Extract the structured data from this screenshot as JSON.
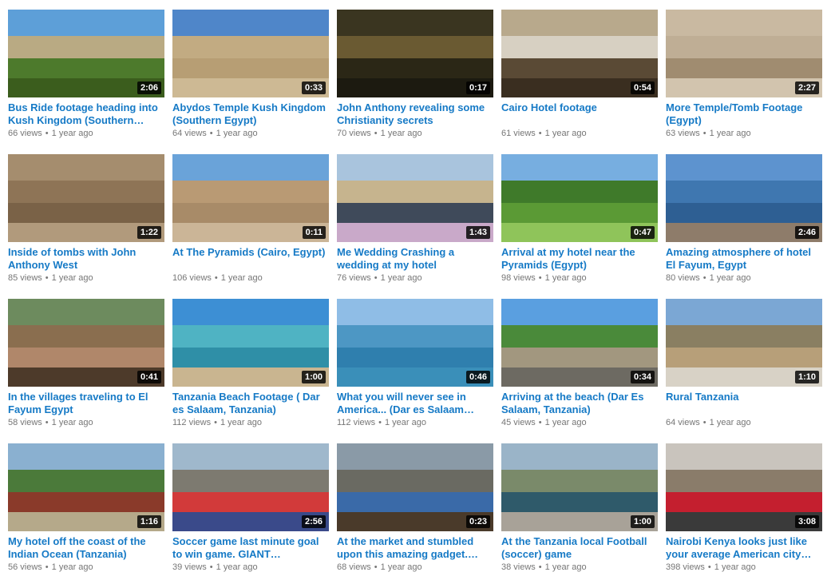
{
  "videos": [
    {
      "title": "Bus Ride footage heading into Kush Kingdom (Southern…",
      "duration": "2:06",
      "views": "66 views",
      "age": "1 year ago",
      "palette": [
        "#5d9fd8",
        "#b9aa83",
        "#4d7a2c",
        "#3b5d1d"
      ]
    },
    {
      "title": "Abydos Temple Kush Kingdom (Southern Egypt)",
      "duration": "0:33",
      "views": "64 views",
      "age": "1 year ago",
      "palette": [
        "#4f86c9",
        "#c2ab82",
        "#b79e74",
        "#cdb994"
      ]
    },
    {
      "title": "John Anthony revealing some Christianity secrets",
      "duration": "0:17",
      "views": "70 views",
      "age": "1 year ago",
      "palette": [
        "#3a3520",
        "#6a5a32",
        "#2b2716",
        "#1c1a10"
      ]
    },
    {
      "title": "Cairo Hotel footage",
      "duration": "0:54",
      "views": "61 views",
      "age": "1 year ago",
      "palette": [
        "#b8a98c",
        "#d7d0c2",
        "#5a4a35",
        "#3a2e20"
      ]
    },
    {
      "title": "More Temple/Tomb Footage (Egypt)",
      "duration": "2:27",
      "views": "63 views",
      "age": "1 year ago",
      "palette": [
        "#c9b9a1",
        "#bfae95",
        "#a08c70",
        "#d2c4ae"
      ]
    },
    {
      "title": "Inside of tombs with John Anthony West",
      "duration": "1:22",
      "views": "85 views",
      "age": "1 year ago",
      "palette": [
        "#a58d6e",
        "#8e7456",
        "#7a6247",
        "#b19a7c"
      ]
    },
    {
      "title": "At The Pyramids (Cairo, Egypt)",
      "duration": "0:11",
      "views": "106 views",
      "age": "1 year ago",
      "palette": [
        "#6aa3d9",
        "#b99a74",
        "#a88b68",
        "#cbb597"
      ]
    },
    {
      "title": "Me Wedding Crashing a wedding at my hotel",
      "duration": "1:43",
      "views": "76 views",
      "age": "1 year ago",
      "palette": [
        "#a9c4dd",
        "#c6b48e",
        "#3f4a5a",
        "#c9a9c9"
      ]
    },
    {
      "title": "Arrival at my hotel near the Pyramids (Egypt)",
      "duration": "0:47",
      "views": "98 views",
      "age": "1 year ago",
      "palette": [
        "#77aee0",
        "#3f7a2a",
        "#5b9a35",
        "#8fc45a"
      ]
    },
    {
      "title": "Amazing atmosphere of hotel El Fayum, Egypt",
      "duration": "2:46",
      "views": "80 views",
      "age": "1 year ago",
      "palette": [
        "#5d93cf",
        "#3f77b0",
        "#2e5f93",
        "#8e7c6a"
      ]
    },
    {
      "title": "In the villages traveling to El Fayum Egypt",
      "duration": "0:41",
      "views": "58 views",
      "age": "1 year ago",
      "palette": [
        "#6d8b5e",
        "#8a6e4f",
        "#b0876a",
        "#4d3a2a"
      ]
    },
    {
      "title": "Tanzania Beach Footage ( Dar es Salaam, Tanzania)",
      "duration": "1:00",
      "views": "112 views",
      "age": "1 year ago",
      "palette": [
        "#3d8fd4",
        "#4fb3c3",
        "#2f8fa7",
        "#c9b590"
      ]
    },
    {
      "title": "What you will never see in America... (Dar es Salaam…",
      "duration": "0:46",
      "views": "112 views",
      "age": "1 year ago",
      "palette": [
        "#8fbde6",
        "#4d97c4",
        "#2f7fae",
        "#3a8fb9"
      ]
    },
    {
      "title": "Arriving at the beach (Dar Es Salaam, Tanzania)",
      "duration": "0:34",
      "views": "45 views",
      "age": "1 year ago",
      "palette": [
        "#5a9fe0",
        "#4a8a3a",
        "#a2977f",
        "#6d6a62"
      ]
    },
    {
      "title": "Rural Tanzania",
      "duration": "1:10",
      "views": "64 views",
      "age": "1 year ago",
      "palette": [
        "#7ba7d4",
        "#8a7f62",
        "#b79f79",
        "#d8d2c6"
      ]
    },
    {
      "title": "My hotel off the coast of the Indian Ocean (Tanzania)",
      "duration": "1:16",
      "views": "56 views",
      "age": "1 year ago",
      "palette": [
        "#8ab0d0",
        "#4b7a3a",
        "#8a3a2a",
        "#b5a98a"
      ]
    },
    {
      "title": "Soccer game last minute goal to win game. GIANT…",
      "duration": "2:56",
      "views": "39 views",
      "age": "1 year ago",
      "palette": [
        "#9fb8cc",
        "#7d7a70",
        "#d23a3a",
        "#3a4a8a"
      ]
    },
    {
      "title": "At the market and stumbled upon this amazing gadget.…",
      "duration": "0:23",
      "views": "68 views",
      "age": "1 year ago",
      "palette": [
        "#8a9aa7",
        "#6a6a62",
        "#3a6aa8",
        "#4a3a2a"
      ]
    },
    {
      "title": "At the Tanzania local Football (soccer) game",
      "duration": "1:00",
      "views": "38 views",
      "age": "1 year ago",
      "palette": [
        "#9ab4c8",
        "#7a8a6a",
        "#2f5a6a",
        "#a8a298"
      ]
    },
    {
      "title": "Nairobi Kenya looks just like your average American city…",
      "duration": "3:08",
      "views": "398 views",
      "age": "1 year ago",
      "palette": [
        "#c9c4bd",
        "#8a7c6a",
        "#c41f2f",
        "#3a3a3a"
      ]
    }
  ]
}
